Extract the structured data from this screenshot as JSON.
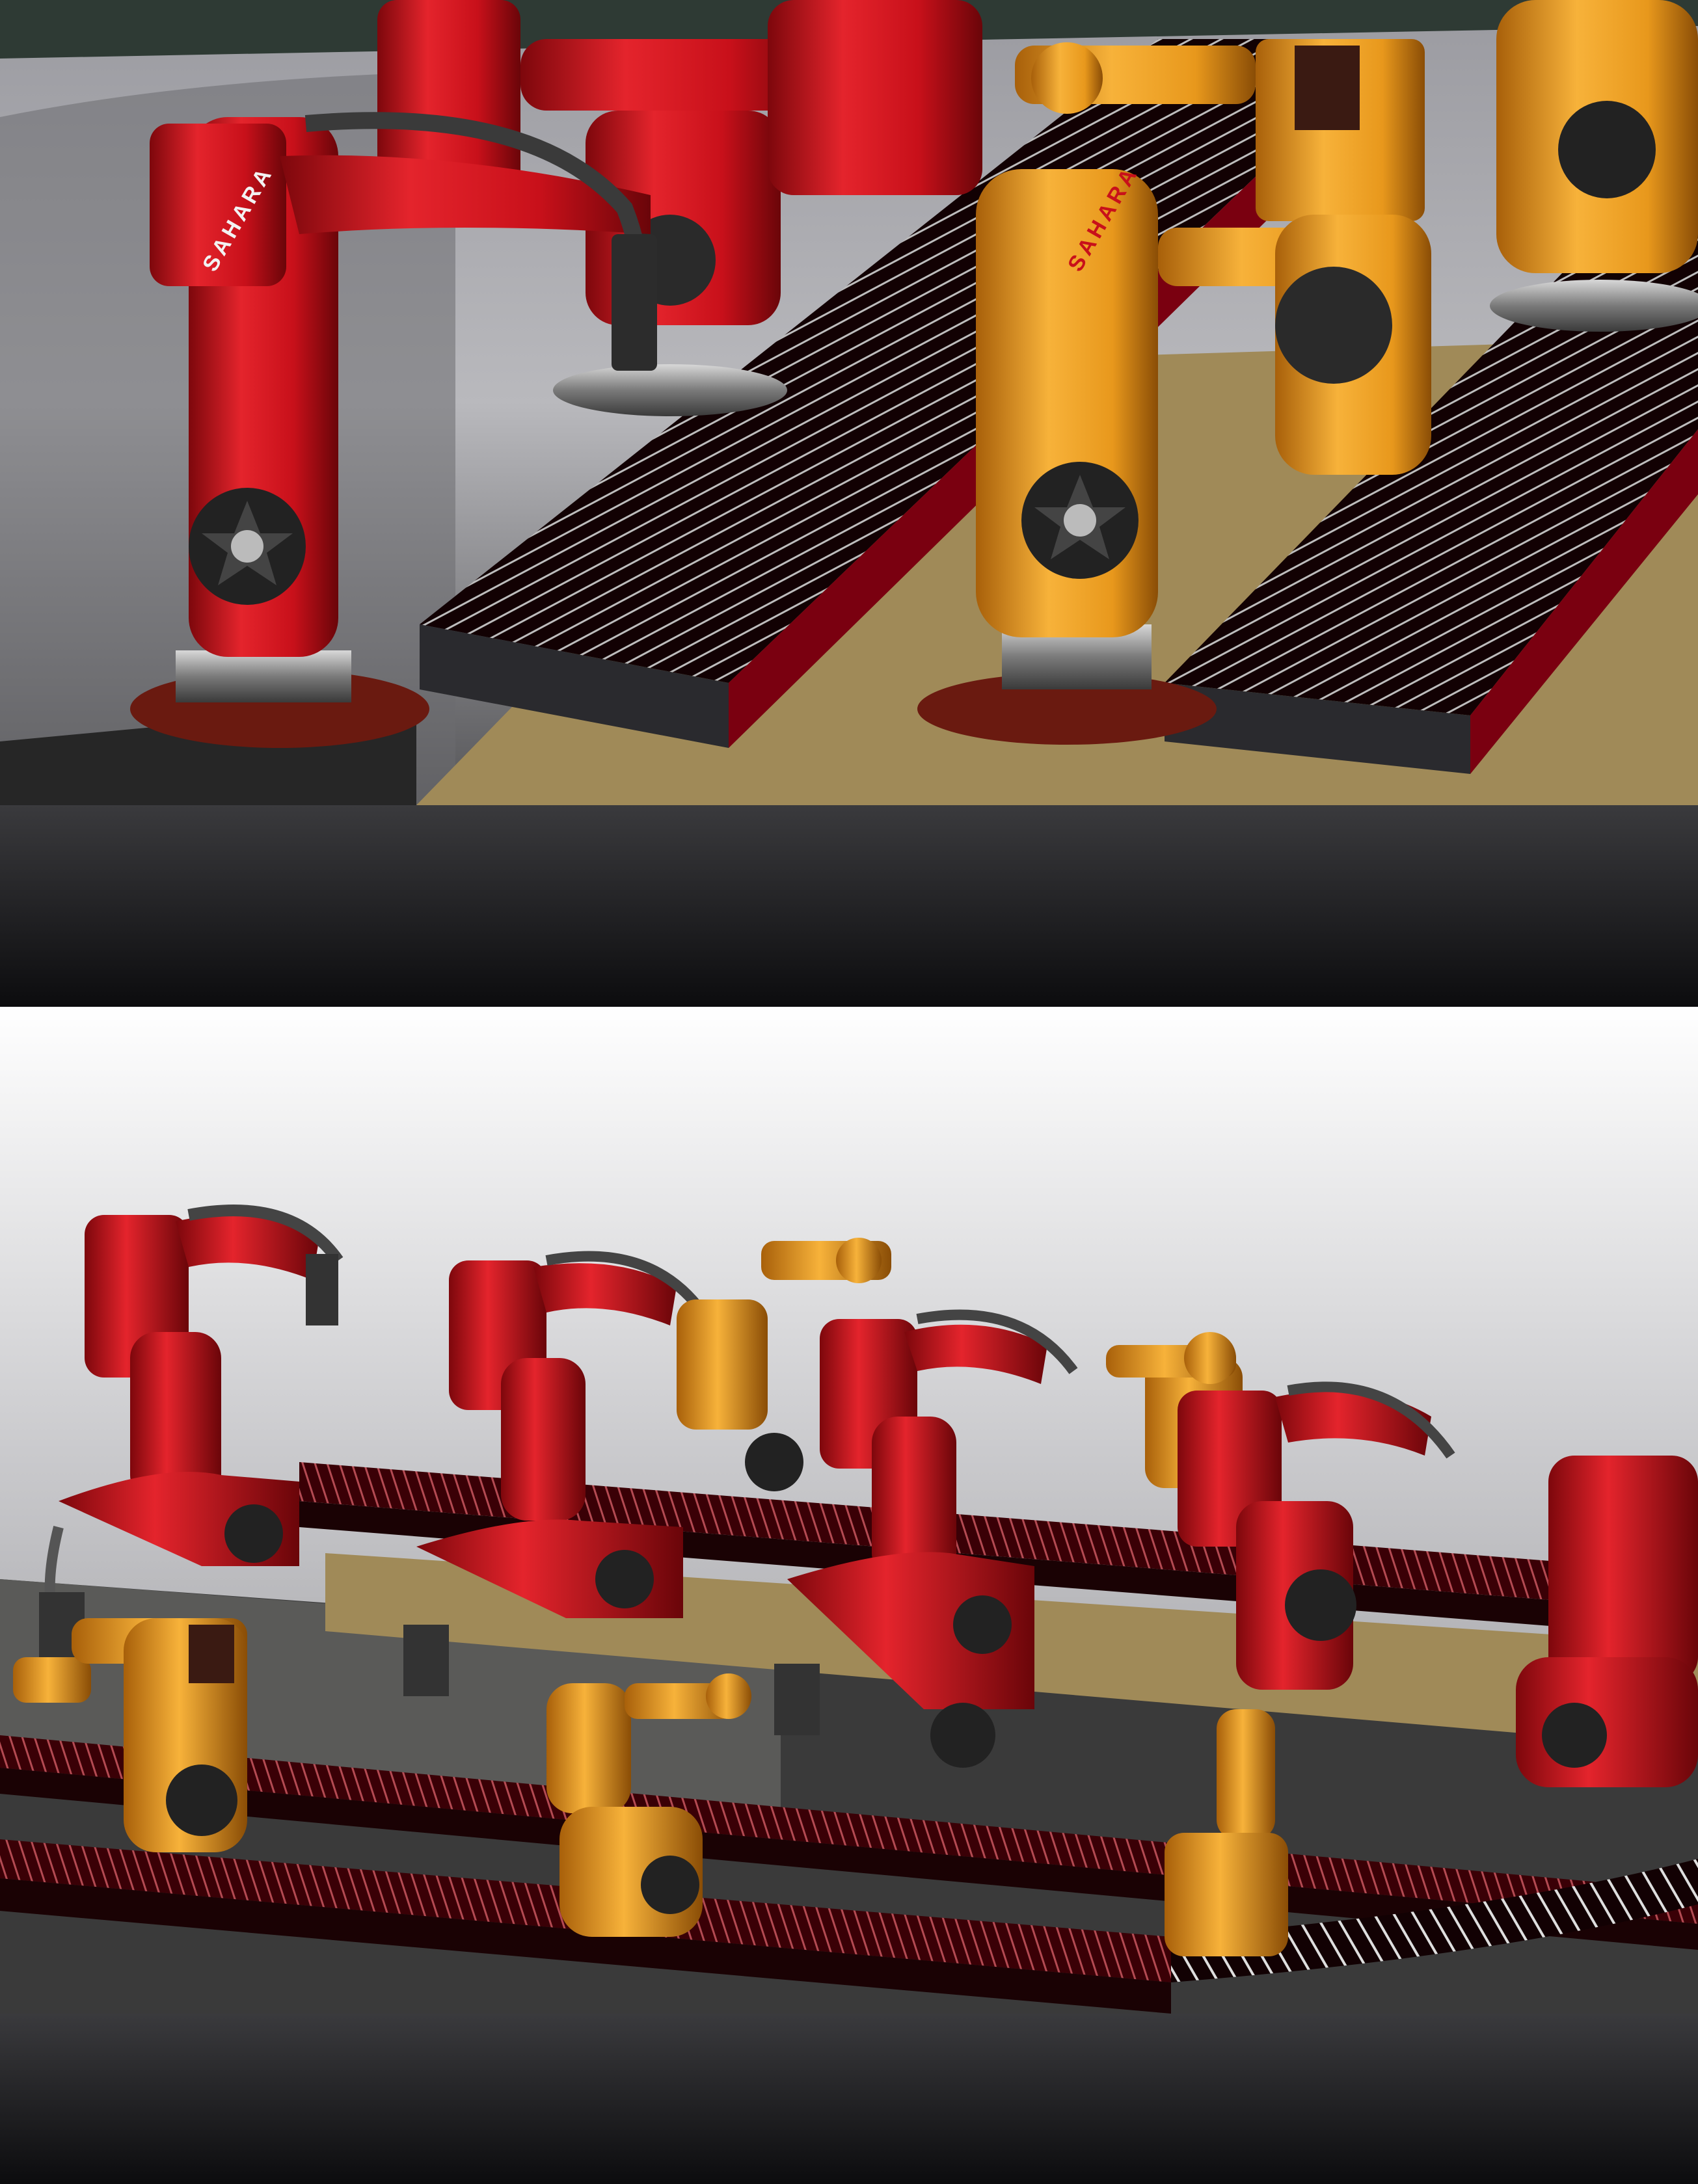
{
  "robot_brand": "SAHARA",
  "colors": {
    "robot_red": "#c8101a",
    "robot_red_shade": "#7d070c",
    "robot_orange": "#e8981c",
    "robot_orange_shade": "#a8600a",
    "conveyor_dark": "#1a0204",
    "conveyor_red": "#7a0010",
    "floor_tan": "#a08a58",
    "band_dark": "#1b1b1d"
  },
  "icons": {
    "joint": "star-hub-icon"
  }
}
